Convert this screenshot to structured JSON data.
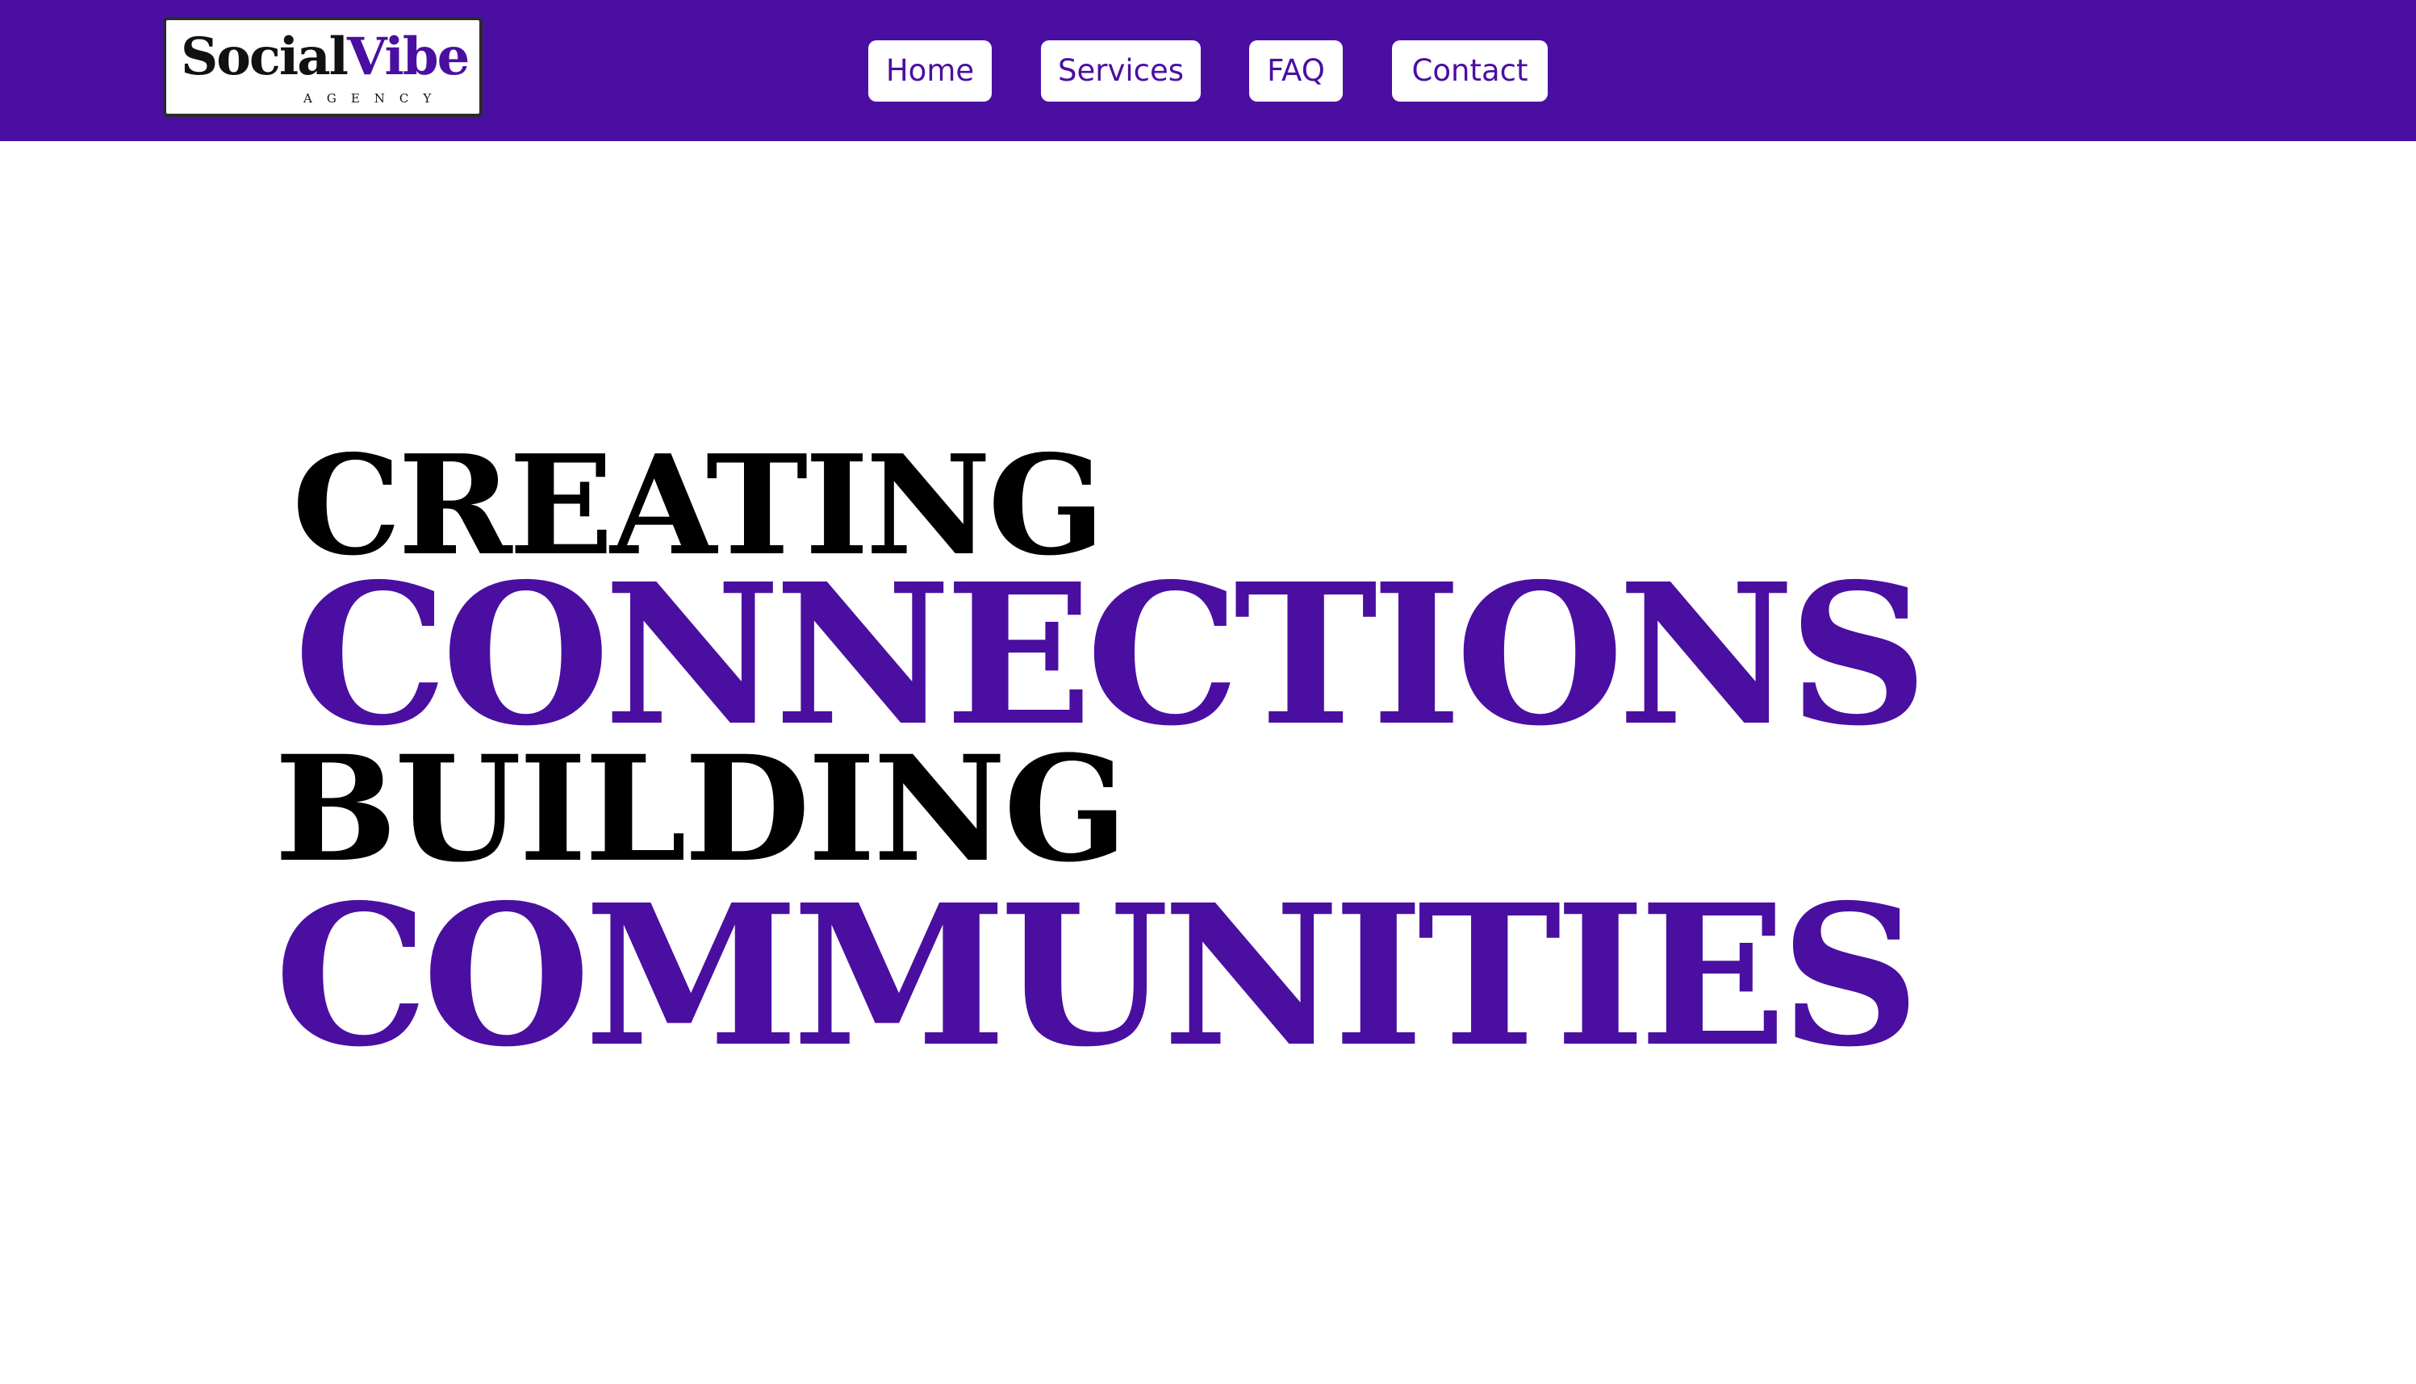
{
  "header": {
    "logo": {
      "word_dark": "Social",
      "word_accent": "Vibe",
      "tagline": "AGENCY"
    },
    "nav": [
      {
        "label": "Home"
      },
      {
        "label": "Services"
      },
      {
        "label": "FAQ"
      },
      {
        "label": "Contact"
      }
    ]
  },
  "hero": {
    "line1": "CREATING",
    "line2": "CONNECTIONS",
    "line3": "BUILDING",
    "line4": "COMMUNITIES"
  },
  "colors": {
    "brand_purple": "#4a0fa1",
    "text_black": "#000000",
    "page_background": "#ffffff"
  }
}
